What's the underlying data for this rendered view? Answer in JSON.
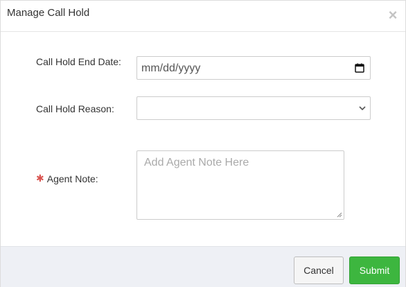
{
  "dialog": {
    "title": "Manage Call Hold",
    "close_glyph": "×"
  },
  "form": {
    "end_date": {
      "label": "Call Hold End Date:",
      "value": "mm/dd/yyyy",
      "icon": "calendar-icon"
    },
    "reason": {
      "label": "Call Hold Reason:",
      "selected": "",
      "icon": "chevron-down-icon"
    },
    "agent_note": {
      "required_marker": "✱",
      "label": "Agent Note:",
      "placeholder": "Add Agent Note Here",
      "value": ""
    }
  },
  "footer": {
    "cancel_label": "Cancel",
    "submit_label": "Submit"
  },
  "colors": {
    "submit_bg": "#3db63f",
    "required": "#d9534f",
    "footer_bg": "#eef0f5"
  }
}
